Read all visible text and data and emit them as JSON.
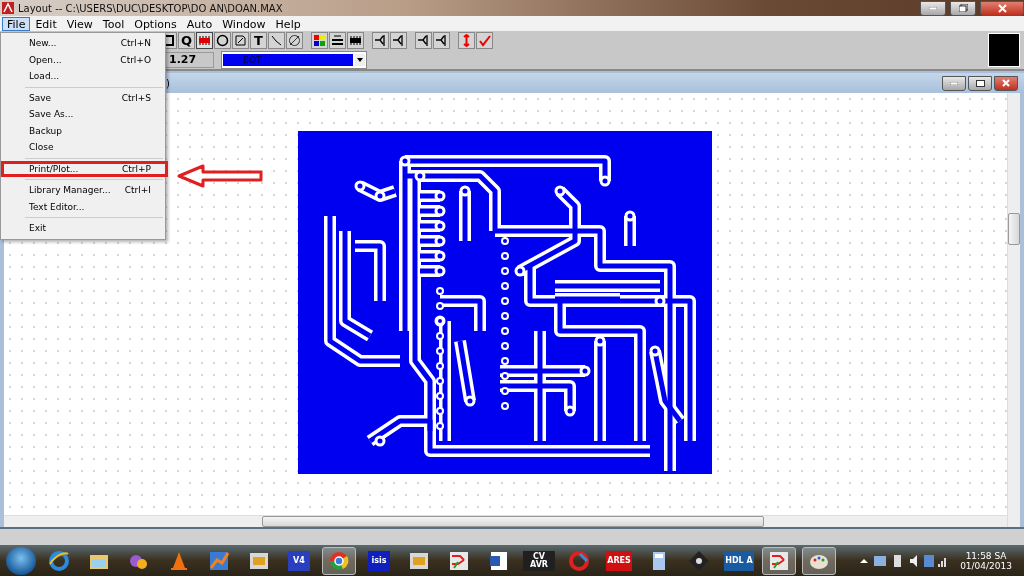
{
  "window": {
    "title": "Layout -- C:\\USERS\\DUC\\DESKTOP\\DO AN\\DOAN.MAX"
  },
  "menu_bar": [
    {
      "label": "File",
      "selected": true
    },
    {
      "label": "Edit",
      "selected": false
    },
    {
      "label": "View",
      "selected": false
    },
    {
      "label": "Tool",
      "selected": false
    },
    {
      "label": "Options",
      "selected": false
    },
    {
      "label": "Auto",
      "selected": false
    },
    {
      "label": "Window",
      "selected": false
    },
    {
      "label": "Help",
      "selected": false
    }
  ],
  "file_menu": [
    {
      "kind": "item",
      "label": "New...",
      "shortcut": "Ctrl+N",
      "annotated": false
    },
    {
      "kind": "item",
      "label": "Open...",
      "shortcut": "Ctrl+O",
      "annotated": false
    },
    {
      "kind": "item",
      "label": "Load...",
      "annotated": false
    },
    {
      "kind": "separator"
    },
    {
      "kind": "item",
      "label": "Save",
      "shortcut": "Ctrl+S",
      "annotated": false
    },
    {
      "kind": "item",
      "label": "Save As...",
      "annotated": false
    },
    {
      "kind": "item",
      "label": "Backup",
      "annotated": false
    },
    {
      "kind": "item",
      "label": "Close",
      "annotated": false
    },
    {
      "kind": "separator"
    },
    {
      "kind": "item",
      "label": "Print/Plot...",
      "shortcut": "Ctrl+P",
      "annotated": true
    },
    {
      "kind": "separator"
    },
    {
      "kind": "item",
      "label": "Library Manager...",
      "shortcut": "Ctrl+I",
      "annotated": false
    },
    {
      "kind": "item",
      "label": "Text Editor...",
      "annotated": false
    },
    {
      "kind": "separator"
    },
    {
      "kind": "item",
      "label": "Exit",
      "annotated": false
    }
  ],
  "toolbar": [
    {
      "kind": "box"
    },
    {
      "kind": "glyph",
      "text": "Q"
    },
    {
      "kind": "chip",
      "selected": true
    },
    {
      "kind": "circle"
    },
    {
      "kind": "pencil"
    },
    {
      "kind": "glyph",
      "text": "T"
    },
    {
      "kind": "line"
    },
    {
      "kind": "circle-slash"
    },
    {
      "kind": "gap"
    },
    {
      "kind": "colors"
    },
    {
      "kind": "drc"
    },
    {
      "kind": "chip"
    },
    {
      "kind": "gap"
    },
    {
      "kind": "route"
    },
    {
      "kind": "route"
    },
    {
      "kind": "gap"
    },
    {
      "kind": "route"
    },
    {
      "kind": "route"
    },
    {
      "kind": "gap"
    },
    {
      "kind": "arrow"
    },
    {
      "kind": "check"
    }
  ],
  "grid_field": {
    "value": "1.27"
  },
  "layer_dropdown": {
    "value": "BOT",
    "color": "#0000f0"
  },
  "child_window": {
    "title": ")"
  },
  "taskbar": {
    "apps": [
      {
        "kind": "ie",
        "active": false
      },
      {
        "kind": "folder",
        "active": false
      },
      {
        "kind": "messenger",
        "active": false
      },
      {
        "kind": "cone",
        "active": false
      },
      {
        "kind": "chart",
        "active": false
      },
      {
        "kind": "chipapp",
        "active": false
      },
      {
        "kind": "logo",
        "label": "V4",
        "color": "#2a3fc0",
        "active": false
      },
      {
        "kind": "chrome",
        "active": true
      },
      {
        "kind": "logo",
        "label": "isis",
        "color": "#1020c0",
        "active": false
      },
      {
        "kind": "chipapp",
        "active": false
      },
      {
        "kind": "pcb",
        "active": false
      },
      {
        "kind": "word",
        "active": false
      },
      {
        "kind": "logo",
        "label": "CV AVR",
        "color": "#202020",
        "active": false
      },
      {
        "kind": "cleaner",
        "active": false
      },
      {
        "kind": "logo",
        "label": "ARES",
        "color": "#d01010",
        "active": false
      },
      {
        "kind": "calc",
        "active": false
      },
      {
        "kind": "tool",
        "active": false
      },
      {
        "kind": "logo",
        "label": "HDL A",
        "color": "#1a5aa0",
        "active": false
      },
      {
        "kind": "pcb",
        "active": true
      },
      {
        "kind": "paint",
        "active": true
      }
    ]
  },
  "clock": {
    "time": "11:58 SA",
    "date": "01/04/2013"
  }
}
